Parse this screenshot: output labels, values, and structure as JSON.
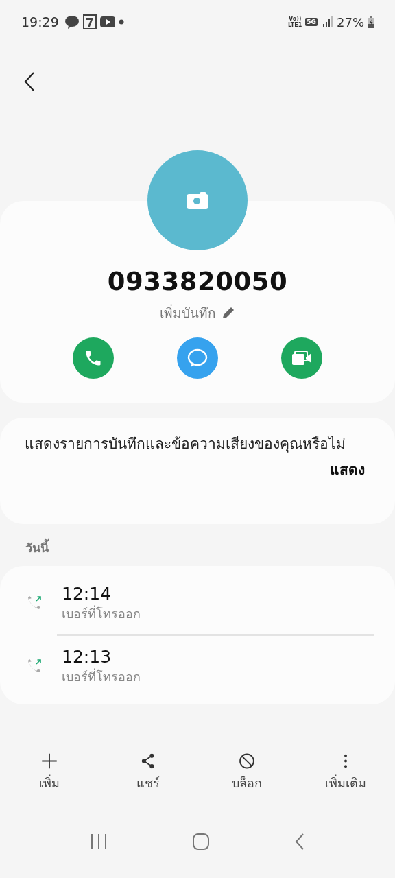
{
  "status_bar": {
    "time": "19:29",
    "volte_top": "Vo))",
    "volte_bottom": "LTE1",
    "network": "5G",
    "battery": "27%"
  },
  "contact": {
    "number": "0933820050",
    "note_button": "เพิ่มบันทึก"
  },
  "actions": [
    {
      "kind": "call"
    },
    {
      "kind": "message"
    },
    {
      "kind": "video"
    }
  ],
  "prompt": {
    "text": "แสดงรายการบันทึกและข้อความเสียงของคุณหรือไม่",
    "button": "แสดง"
  },
  "section": "วันนี้",
  "calls": [
    {
      "time": "12:14",
      "label": "เบอร์ที่โทรออก",
      "kind": "outgoing"
    },
    {
      "time": "12:13",
      "label": "เบอร์ที่โทรออก",
      "kind": "outgoing"
    }
  ],
  "toolbar": [
    {
      "kind": "add",
      "label": "เพิ่ม"
    },
    {
      "kind": "share",
      "label": "แชร์"
    },
    {
      "kind": "block",
      "label": "บล็อก"
    },
    {
      "kind": "more",
      "label": "เพิ่มเติม"
    }
  ]
}
